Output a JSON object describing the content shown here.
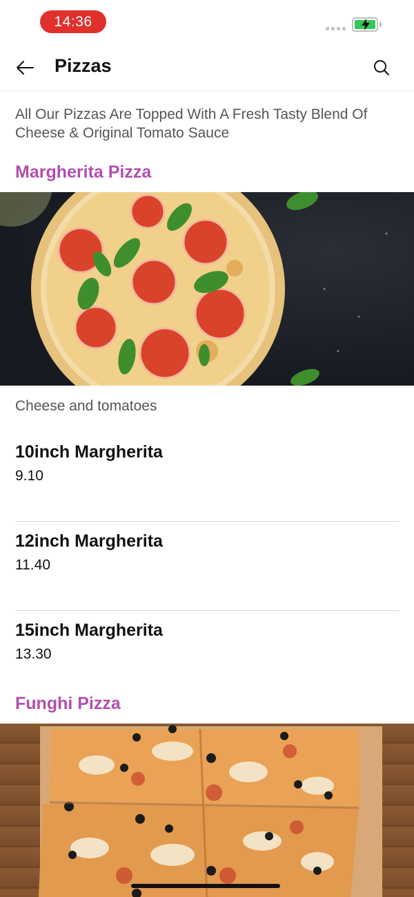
{
  "status_bar": {
    "time": "14:36",
    "battery_color": "#34c759",
    "time_pill_color": "#e0302c"
  },
  "header": {
    "title": "Pizzas",
    "back_icon": "arrow-left-icon",
    "search_icon": "search-icon"
  },
  "intro": "All Our Pizzas Are Topped With A Fresh Tasty Blend Of Cheese & Original Tomato Sauce",
  "accent_color": "#b14fae",
  "sections": [
    {
      "title": "Margherita Pizza",
      "description": "Cheese and tomatoes",
      "options": [
        {
          "name": "10inch Margherita",
          "price": "9.10"
        },
        {
          "name": "12inch Margherita",
          "price": "11.40"
        },
        {
          "name": "15inch Margherita",
          "price": "13.30"
        }
      ]
    },
    {
      "title": "Funghi Pizza"
    }
  ]
}
